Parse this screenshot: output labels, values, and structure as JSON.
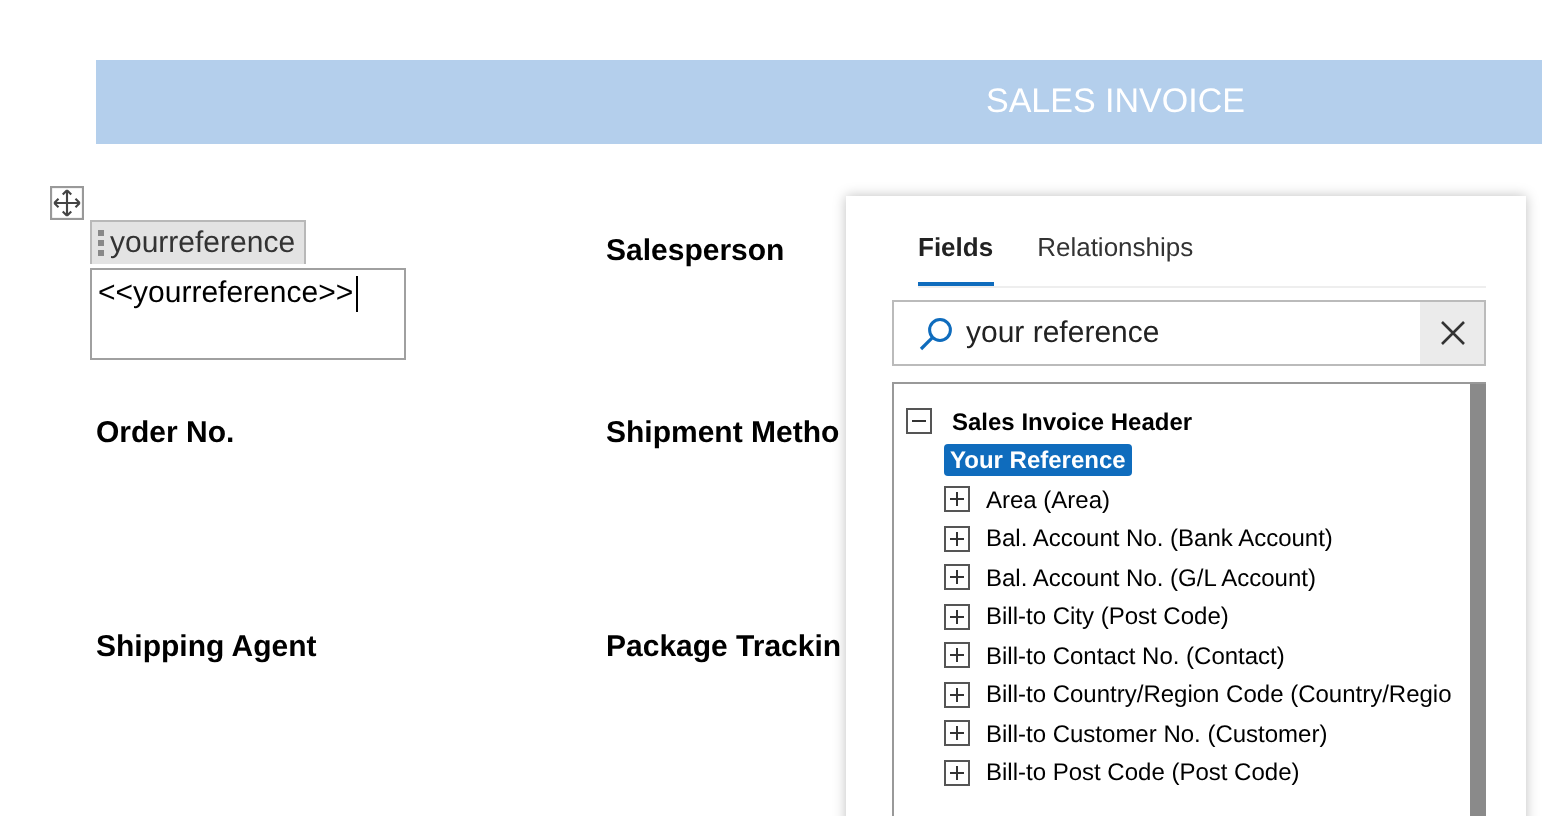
{
  "document": {
    "title": "SALES INVOICE",
    "cells": [
      {
        "kind": "merge",
        "tag": "yourreference",
        "value": "<<yourreference>>"
      },
      {
        "kind": "label",
        "text": "Salesperson"
      },
      {
        "kind": "label",
        "text": "Order No."
      },
      {
        "kind": "label",
        "text": "Shipment Metho"
      },
      {
        "kind": "label",
        "text": "Shipping Agent"
      },
      {
        "kind": "label",
        "text": "Package Trackin"
      }
    ]
  },
  "panel": {
    "tabs": [
      {
        "label": "Fields",
        "selected": true
      },
      {
        "label": "Relationships",
        "selected": false
      }
    ],
    "search": {
      "value": "your reference"
    },
    "tree": {
      "label": "Sales Invoice Header",
      "expanded": true,
      "children": [
        {
          "label": "Your Reference",
          "kind": "field",
          "selected": true
        },
        {
          "label": "Area (Area)",
          "kind": "table",
          "expanded": false,
          "selected": false
        },
        {
          "label": "Bal. Account No. (Bank Account)",
          "kind": "table",
          "expanded": false,
          "selected": false
        },
        {
          "label": "Bal. Account No. (G/L Account)",
          "kind": "table",
          "expanded": false,
          "selected": false
        },
        {
          "label": "Bill-to City (Post Code)",
          "kind": "table",
          "expanded": false,
          "selected": false
        },
        {
          "label": "Bill-to Contact No. (Contact)",
          "kind": "table",
          "expanded": false,
          "selected": false
        },
        {
          "label": "Bill-to Country/Region Code (Country/Regio",
          "kind": "table",
          "expanded": false,
          "selected": false
        },
        {
          "label": "Bill-to Customer No. (Customer)",
          "kind": "table",
          "expanded": false,
          "selected": false
        },
        {
          "label": "Bill-to Post Code (Post Code)",
          "kind": "table",
          "expanded": false,
          "selected": false
        }
      ]
    }
  }
}
